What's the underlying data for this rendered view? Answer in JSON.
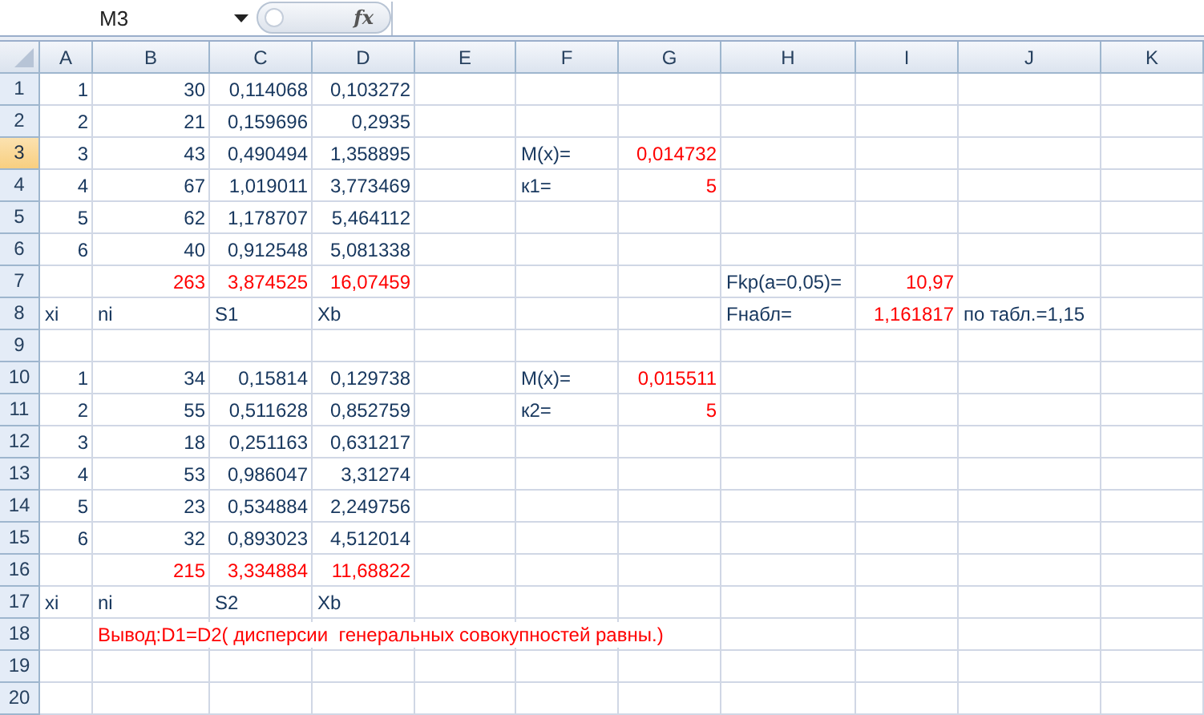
{
  "name_box": {
    "value": "M3"
  },
  "function_button": {
    "label": "fx"
  },
  "columns": [
    {
      "label": "A",
      "selected": false
    },
    {
      "label": "B",
      "selected": false
    },
    {
      "label": "C",
      "selected": false
    },
    {
      "label": "D",
      "selected": false
    },
    {
      "label": "E",
      "selected": false
    },
    {
      "label": "F",
      "selected": false
    },
    {
      "label": "G",
      "selected": false
    },
    {
      "label": "H",
      "selected": false
    },
    {
      "label": "I",
      "selected": false
    },
    {
      "label": "J",
      "selected": false
    },
    {
      "label": "K",
      "selected": false
    }
  ],
  "rows": [
    {
      "label": "1",
      "selected": false,
      "cells": [
        {
          "text": "1",
          "kind": "number",
          "color": "#17375e"
        },
        {
          "text": "30",
          "kind": "number",
          "color": "#17375e"
        },
        {
          "text": "0,114068",
          "kind": "number",
          "color": "#17375e"
        },
        {
          "text": "0,103272",
          "kind": "number",
          "color": "#17375e"
        },
        {},
        {},
        {},
        {},
        {},
        {},
        {}
      ]
    },
    {
      "label": "2",
      "selected": false,
      "cells": [
        {
          "text": "2",
          "kind": "number",
          "color": "#17375e"
        },
        {
          "text": "21",
          "kind": "number",
          "color": "#17375e"
        },
        {
          "text": "0,159696",
          "kind": "number",
          "color": "#17375e"
        },
        {
          "text": "0,2935",
          "kind": "number",
          "color": "#17375e"
        },
        {},
        {},
        {},
        {},
        {},
        {},
        {}
      ]
    },
    {
      "label": "3",
      "selected": true,
      "cells": [
        {
          "text": "3",
          "kind": "number",
          "color": "#17375e"
        },
        {
          "text": "43",
          "kind": "number",
          "color": "#17375e"
        },
        {
          "text": "0,490494",
          "kind": "number",
          "color": "#17375e"
        },
        {
          "text": "1,358895",
          "kind": "number",
          "color": "#17375e"
        },
        {},
        {
          "text": "M(x)=",
          "kind": "text",
          "color": "#17375e"
        },
        {
          "text": "0,014732",
          "kind": "number",
          "color": "#ff0000"
        },
        {},
        {},
        {},
        {}
      ]
    },
    {
      "label": "4",
      "selected": false,
      "cells": [
        {
          "text": "4",
          "kind": "number",
          "color": "#17375e"
        },
        {
          "text": "67",
          "kind": "number",
          "color": "#17375e"
        },
        {
          "text": "1,019011",
          "kind": "number",
          "color": "#17375e"
        },
        {
          "text": "3,773469",
          "kind": "number",
          "color": "#17375e"
        },
        {},
        {
          "text": "к1=",
          "kind": "text",
          "color": "#17375e"
        },
        {
          "text": "5",
          "kind": "number",
          "color": "#ff0000"
        },
        {},
        {},
        {},
        {}
      ]
    },
    {
      "label": "5",
      "selected": false,
      "cells": [
        {
          "text": "5",
          "kind": "number",
          "color": "#17375e"
        },
        {
          "text": "62",
          "kind": "number",
          "color": "#17375e"
        },
        {
          "text": "1,178707",
          "kind": "number",
          "color": "#17375e"
        },
        {
          "text": "5,464112",
          "kind": "number",
          "color": "#17375e"
        },
        {},
        {},
        {},
        {},
        {},
        {},
        {}
      ]
    },
    {
      "label": "6",
      "selected": false,
      "cells": [
        {
          "text": "6",
          "kind": "number",
          "color": "#17375e"
        },
        {
          "text": "40",
          "kind": "number",
          "color": "#17375e"
        },
        {
          "text": "0,912548",
          "kind": "number",
          "color": "#17375e"
        },
        {
          "text": "5,081338",
          "kind": "number",
          "color": "#17375e"
        },
        {},
        {},
        {},
        {},
        {},
        {},
        {}
      ]
    },
    {
      "label": "7",
      "selected": false,
      "cells": [
        {},
        {
          "text": "263",
          "kind": "number",
          "color": "#ff0000"
        },
        {
          "text": "3,874525",
          "kind": "number",
          "color": "#ff0000"
        },
        {
          "text": "16,07459",
          "kind": "number",
          "color": "#ff0000"
        },
        {},
        {},
        {},
        {
          "text": "Fkp(a=0,05)=",
          "kind": "text",
          "color": "#17375e"
        },
        {
          "text": "10,97",
          "kind": "number",
          "color": "#ff0000"
        },
        {},
        {}
      ]
    },
    {
      "label": "8",
      "selected": false,
      "cells": [
        {
          "text": "xi",
          "kind": "text",
          "color": "#17375e"
        },
        {
          "text": "ni",
          "kind": "text",
          "color": "#17375e"
        },
        {
          "text": "S1",
          "kind": "text",
          "color": "#17375e"
        },
        {
          "text": "Xb",
          "kind": "text",
          "color": "#17375e"
        },
        {},
        {},
        {},
        {
          "text": "Fнабл=",
          "kind": "text",
          "color": "#17375e"
        },
        {
          "text": "1,161817",
          "kind": "number",
          "color": "#ff0000"
        },
        {
          "text": "по табл.=1,15",
          "kind": "text",
          "color": "#17375e"
        },
        {}
      ]
    },
    {
      "label": "9",
      "selected": false,
      "cells": [
        {},
        {},
        {},
        {},
        {},
        {},
        {},
        {},
        {},
        {},
        {}
      ]
    },
    {
      "label": "10",
      "selected": false,
      "cells": [
        {
          "text": "1",
          "kind": "number",
          "color": "#17375e"
        },
        {
          "text": "34",
          "kind": "number",
          "color": "#17375e"
        },
        {
          "text": "0,15814",
          "kind": "number",
          "color": "#17375e"
        },
        {
          "text": "0,129738",
          "kind": "number",
          "color": "#17375e"
        },
        {},
        {
          "text": "M(x)=",
          "kind": "text",
          "color": "#17375e"
        },
        {
          "text": "0,015511",
          "kind": "number",
          "color": "#ff0000"
        },
        {},
        {},
        {},
        {}
      ]
    },
    {
      "label": "11",
      "selected": false,
      "cells": [
        {
          "text": "2",
          "kind": "number",
          "color": "#17375e"
        },
        {
          "text": "55",
          "kind": "number",
          "color": "#17375e"
        },
        {
          "text": "0,511628",
          "kind": "number",
          "color": "#17375e"
        },
        {
          "text": "0,852759",
          "kind": "number",
          "color": "#17375e"
        },
        {},
        {
          "text": "к2=",
          "kind": "text",
          "color": "#17375e"
        },
        {
          "text": "5",
          "kind": "number",
          "color": "#ff0000"
        },
        {},
        {},
        {},
        {}
      ]
    },
    {
      "label": "12",
      "selected": false,
      "cells": [
        {
          "text": "3",
          "kind": "number",
          "color": "#17375e"
        },
        {
          "text": "18",
          "kind": "number",
          "color": "#17375e"
        },
        {
          "text": "0,251163",
          "kind": "number",
          "color": "#17375e"
        },
        {
          "text": "0,631217",
          "kind": "number",
          "color": "#17375e"
        },
        {},
        {},
        {},
        {},
        {},
        {},
        {}
      ]
    },
    {
      "label": "13",
      "selected": false,
      "cells": [
        {
          "text": "4",
          "kind": "number",
          "color": "#17375e"
        },
        {
          "text": "53",
          "kind": "number",
          "color": "#17375e"
        },
        {
          "text": "0,986047",
          "kind": "number",
          "color": "#17375e"
        },
        {
          "text": "3,31274",
          "kind": "number",
          "color": "#17375e"
        },
        {},
        {},
        {},
        {},
        {},
        {},
        {}
      ]
    },
    {
      "label": "14",
      "selected": false,
      "cells": [
        {
          "text": "5",
          "kind": "number",
          "color": "#17375e"
        },
        {
          "text": "23",
          "kind": "number",
          "color": "#17375e"
        },
        {
          "text": "0,534884",
          "kind": "number",
          "color": "#17375e"
        },
        {
          "text": "2,249756",
          "kind": "number",
          "color": "#17375e"
        },
        {},
        {},
        {},
        {},
        {},
        {},
        {}
      ]
    },
    {
      "label": "15",
      "selected": false,
      "cells": [
        {
          "text": "6",
          "kind": "number",
          "color": "#17375e"
        },
        {
          "text": "32",
          "kind": "number",
          "color": "#17375e"
        },
        {
          "text": "0,893023",
          "kind": "number",
          "color": "#17375e"
        },
        {
          "text": "4,512014",
          "kind": "number",
          "color": "#17375e"
        },
        {},
        {},
        {},
        {},
        {},
        {},
        {}
      ]
    },
    {
      "label": "16",
      "selected": false,
      "cells": [
        {},
        {
          "text": "215",
          "kind": "number",
          "color": "#ff0000"
        },
        {
          "text": "3,334884",
          "kind": "number",
          "color": "#ff0000"
        },
        {
          "text": "11,68822",
          "kind": "number",
          "color": "#ff0000"
        },
        {},
        {},
        {},
        {},
        {},
        {},
        {}
      ]
    },
    {
      "label": "17",
      "selected": false,
      "cells": [
        {
          "text": "xi",
          "kind": "text",
          "color": "#17375e"
        },
        {
          "text": "ni",
          "kind": "text",
          "color": "#17375e"
        },
        {
          "text": "S2",
          "kind": "text",
          "color": "#17375e"
        },
        {
          "text": "Xb",
          "kind": "text",
          "color": "#17375e"
        },
        {},
        {},
        {},
        {},
        {},
        {},
        {}
      ]
    },
    {
      "label": "18",
      "selected": false,
      "cells": [
        {},
        {
          "text": "Вывод:D1=D2( дисперсии  генеральных совокупностей равны.)",
          "kind": "text",
          "color": "#ff0000"
        },
        {},
        {},
        {},
        {},
        {},
        {},
        {},
        {},
        {}
      ]
    },
    {
      "label": "19",
      "selected": false,
      "cells": [
        {},
        {},
        {},
        {},
        {},
        {},
        {},
        {},
        {},
        {},
        {}
      ]
    },
    {
      "label": "20",
      "selected": false,
      "cells": [
        {},
        {},
        {},
        {},
        {},
        {},
        {},
        {},
        {},
        {},
        {}
      ]
    }
  ]
}
